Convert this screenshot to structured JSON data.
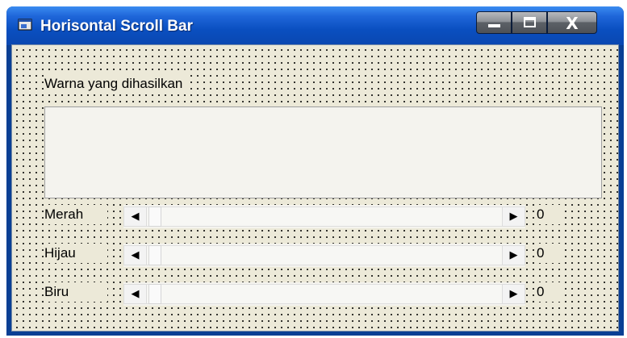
{
  "window": {
    "title": "Horisontal Scroll Bar",
    "buttons": {
      "minimize": "minimize",
      "maximize": "maximize",
      "close_label": "X"
    }
  },
  "form": {
    "color_label": "Warna yang dihasilkan",
    "sliders": [
      {
        "label": "Merah",
        "value": "0",
        "level": 0
      },
      {
        "label": "Hijau",
        "value": "0",
        "level": 0
      },
      {
        "label": "Biru",
        "value": "0",
        "level": 0
      }
    ],
    "arrows": {
      "left": "◀",
      "right": "▶"
    }
  },
  "icons": [
    "app-icon",
    "minimize-icon",
    "maximize-icon",
    "close-icon",
    "arrow-left-icon",
    "arrow-right-icon"
  ]
}
